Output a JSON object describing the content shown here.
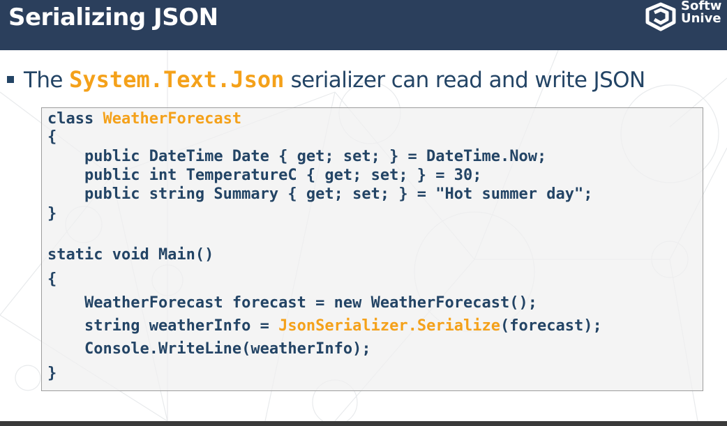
{
  "header": {
    "title": "Serializing JSON",
    "logo_line1": "Softw",
    "logo_line2": "Unive",
    "background_color": "#2b3f5c"
  },
  "bullet": {
    "text_before": "The ",
    "highlight": "System.Text.Json",
    "text_after": " serializer can read and write JSON"
  },
  "code": {
    "line1": {
      "keyword": "class ",
      "type": "WeatherForecast"
    },
    "line2": "{",
    "line3": "    public DateTime Date { get; set; } = DateTime.Now;",
    "line4": "    public int TemperatureC { get; set; } = 30;",
    "line5": "    public string Summary { get; set; } = \"Hot summer day\";",
    "line6": "}",
    "line7": "static void Main()",
    "line8": "{",
    "line9": "    WeatherForecast forecast = new WeatherForecast();",
    "line10": {
      "prefix": "    string weatherInfo = ",
      "cls": "JsonSerializer",
      "dot": ".",
      "method": "Serialize",
      "suffix": "(forecast);"
    },
    "line11": "    Console.WriteLine(weatherInfo);",
    "line12": "}"
  },
  "colors": {
    "text_dark_blue": "#234465",
    "highlight_orange": "#f4a11a"
  }
}
